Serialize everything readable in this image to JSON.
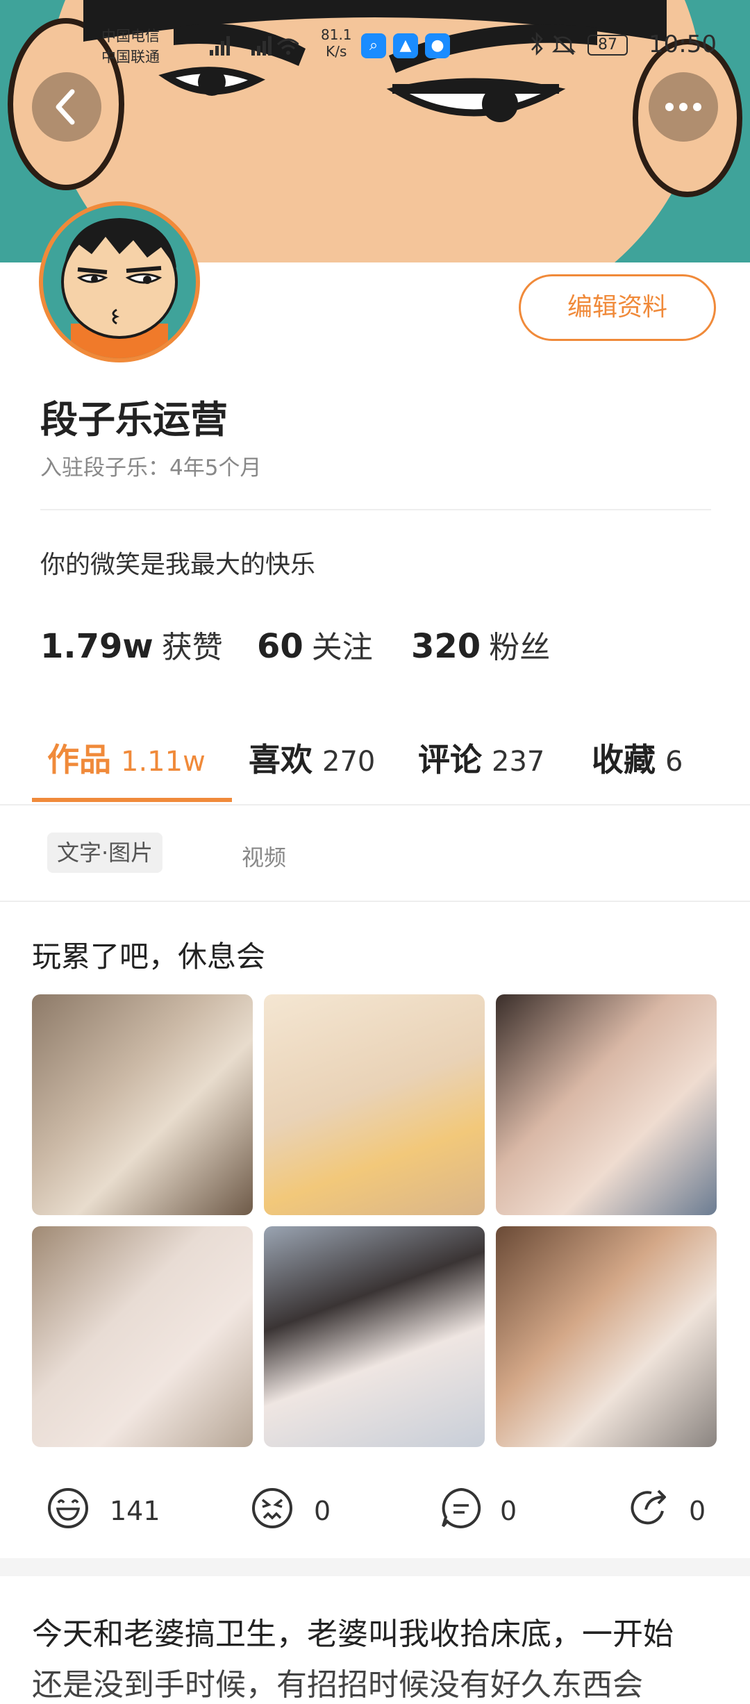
{
  "status_bar": {
    "carrier1": "中国电信",
    "carrier2": "中国联通",
    "speed_value": "81.1",
    "speed_unit": "K/s",
    "battery": "87",
    "time": "10:50"
  },
  "profile": {
    "edit_label": "编辑资料",
    "username": "段子乐运营",
    "joined": "入驻段子乐：4年5个月",
    "bio": "你的微笑是我最大的快乐",
    "stats": [
      {
        "value": "1.79w",
        "label": "获赞"
      },
      {
        "value": "60",
        "label": "关注"
      },
      {
        "value": "320",
        "label": "粉丝"
      }
    ]
  },
  "tabs": [
    {
      "label": "作品",
      "count": "1.11w"
    },
    {
      "label": "喜欢",
      "count": "270"
    },
    {
      "label": "评论",
      "count": "237"
    },
    {
      "label": "收藏",
      "count": "6"
    }
  ],
  "filters": {
    "active": "文字·图片",
    "other": "视频"
  },
  "post": {
    "title": "玩累了吧，休息会",
    "reactions": {
      "laugh": "141",
      "angry": "0",
      "comment": "0",
      "share": "0"
    }
  },
  "next_post": {
    "line1": "今天和老婆搞卫生，老婆叫我收拾床底，一开始",
    "line2": "还是没到手时候，有招招时候没有好久东西会"
  },
  "colors": {
    "accent": "#f08a3a",
    "banner": "#3fa39a"
  }
}
